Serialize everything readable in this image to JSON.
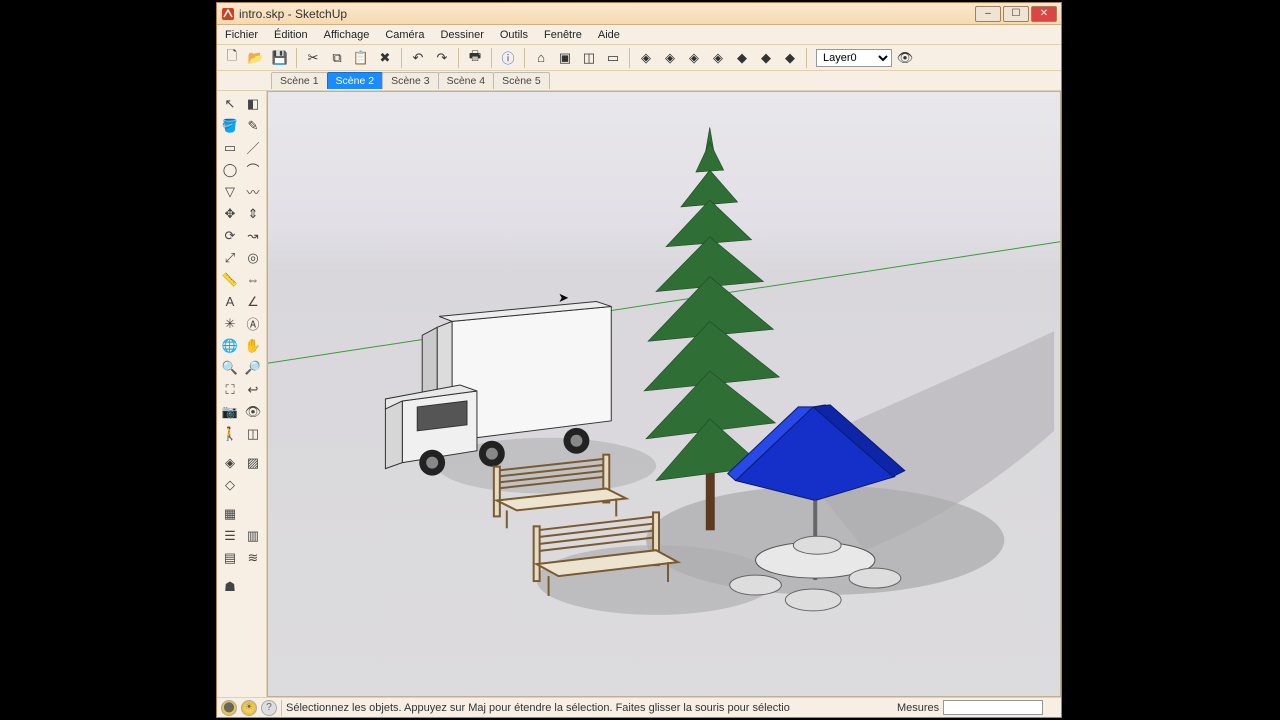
{
  "window": {
    "title": "intro.skp - SketchUp"
  },
  "menus": [
    "Fichier",
    "Édition",
    "Affichage",
    "Caméra",
    "Dessiner",
    "Outils",
    "Fenêtre",
    "Aide"
  ],
  "layer_selected": "Layer0",
  "scenes": {
    "items": [
      "Scène 1",
      "Scène 2",
      "Scène 3",
      "Scène 4",
      "Scène 5"
    ],
    "active_index": 1
  },
  "status": {
    "hint": "Sélectionnez les objets. Appuyez sur Maj pour étendre la sélection. Faites glisser la souris pour sélectio",
    "measures_label": "Mesures",
    "measures_value": ""
  },
  "toolbar_icons": [
    "new",
    "open",
    "save",
    "cut",
    "copy",
    "paste",
    "delete",
    "undo",
    "redo",
    "print",
    "info",
    "home",
    "gallery",
    "window",
    "page",
    "iso-front",
    "iso-back",
    "iso-left",
    "iso-right",
    "iso-top",
    "iso-bottom",
    "iso-persp",
    "layers-visibility"
  ],
  "left_tools": [
    [
      "select",
      "eraser"
    ],
    [
      "paint",
      "draw"
    ],
    [
      "rectangle",
      "line"
    ],
    [
      "circle",
      "arc"
    ],
    [
      "polygon",
      "freehand"
    ],
    [
      "move",
      "pushpull"
    ],
    [
      "rotate",
      "followme"
    ],
    [
      "scale",
      "offset"
    ],
    [
      "tape",
      "dimension"
    ],
    [
      "text",
      "protractor"
    ],
    [
      "axes",
      "3dtext"
    ],
    [
      "orbit",
      "pan"
    ],
    [
      "zoom",
      "zoom-window"
    ],
    [
      "zoom-extents",
      "previous"
    ],
    [
      "position-camera",
      "look-around"
    ],
    [
      "walk",
      "section"
    ],
    [],
    [
      "iso-view",
      "face-style"
    ],
    [
      "xray",
      ""
    ],
    [],
    [
      "component",
      ""
    ],
    [
      "outliner",
      "shadows"
    ],
    [
      "shadows2",
      "fog"
    ],
    [],
    [
      "layers",
      ""
    ]
  ]
}
